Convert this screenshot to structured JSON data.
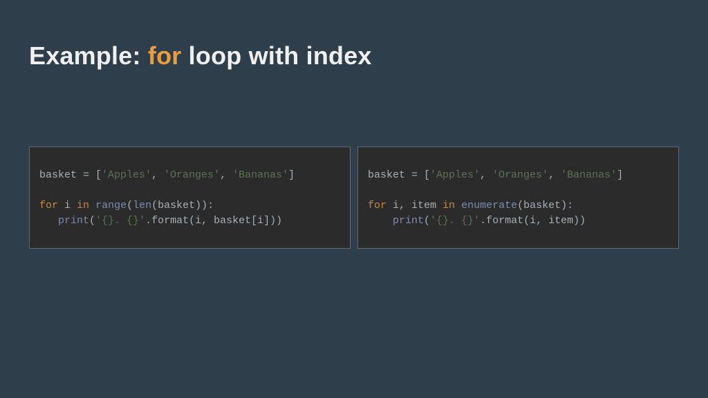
{
  "title_prefix": "Example: ",
  "title_keyword": "for",
  "title_suffix": " loop with index",
  "colors": {
    "background": "#2e3e4a",
    "code_bg": "#2b2b2b",
    "panel_border": "#5f6a72",
    "title_text": "#f0f0f0",
    "accent": "#ec9d3a",
    "syntax_plain": "#a8b0b6",
    "syntax_string": "#5d7158",
    "syntax_keyword": "#c68b3d",
    "syntax_builtin": "#7b8db1"
  },
  "code_left": {
    "raw": "basket = ['Apples', 'Oranges', 'Bananas']\n\nfor i in range(len(basket)):\n   print('{}. {}'.format(i, basket[i]))",
    "tokens": [
      [
        [
          "plain",
          "basket = ["
        ],
        [
          "string",
          "'Apples'"
        ],
        [
          "plain",
          ", "
        ],
        [
          "string",
          "'Oranges'"
        ],
        [
          "plain",
          ", "
        ],
        [
          "string",
          "'Bananas'"
        ],
        [
          "plain",
          "]"
        ]
      ],
      [],
      [
        [
          "keyword",
          "for"
        ],
        [
          "plain",
          " i "
        ],
        [
          "keyword",
          "in"
        ],
        [
          "plain",
          " "
        ],
        [
          "builtin",
          "range"
        ],
        [
          "plain",
          "("
        ],
        [
          "builtin",
          "len"
        ],
        [
          "plain",
          "(basket)):"
        ]
      ],
      [
        [
          "plain",
          "   "
        ],
        [
          "builtin",
          "print"
        ],
        [
          "plain",
          "("
        ],
        [
          "string",
          "'{}. {}'"
        ],
        [
          "plain",
          ".format(i, basket[i]))"
        ]
      ]
    ]
  },
  "code_right": {
    "raw": "basket = ['Apples', 'Oranges', 'Bananas']\n\nfor i, item in enumerate(basket):\n    print('{}. {}'.format(i, item))",
    "tokens": [
      [
        [
          "plain",
          "basket = ["
        ],
        [
          "string",
          "'Apples'"
        ],
        [
          "plain",
          ", "
        ],
        [
          "string",
          "'Oranges'"
        ],
        [
          "plain",
          ", "
        ],
        [
          "string",
          "'Bananas'"
        ],
        [
          "plain",
          "]"
        ]
      ],
      [],
      [
        [
          "keyword",
          "for"
        ],
        [
          "plain",
          " i, item "
        ],
        [
          "keyword",
          "in"
        ],
        [
          "plain",
          " "
        ],
        [
          "builtin",
          "enumerate"
        ],
        [
          "plain",
          "(basket):"
        ]
      ],
      [
        [
          "plain",
          "    "
        ],
        [
          "builtin",
          "print"
        ],
        [
          "plain",
          "("
        ],
        [
          "string",
          "'{}. {}'"
        ],
        [
          "plain",
          ".format(i, item))"
        ]
      ]
    ]
  }
}
